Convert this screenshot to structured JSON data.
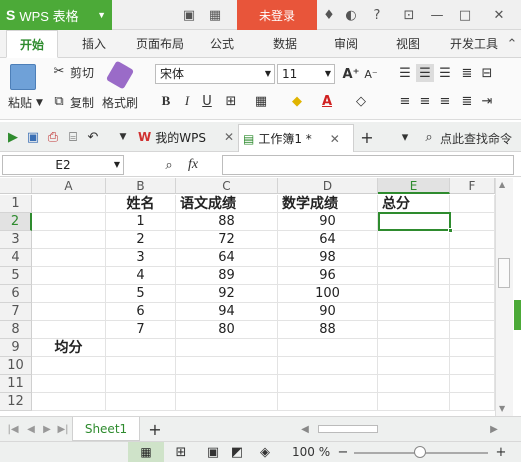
{
  "app": {
    "logo_text": "WPS 表格",
    "login_button": "未登录"
  },
  "ribbon_tabs": [
    "开始",
    "插入",
    "页面布局",
    "公式",
    "数据",
    "审阅",
    "视图",
    "开发工具"
  ],
  "ribbon": {
    "paste": "粘贴",
    "cut": "剪切",
    "copy": "复制",
    "format_painter": "格式刷",
    "font_name": "宋体",
    "font_size": "11",
    "bold": "B",
    "italic": "I",
    "underline": "U"
  },
  "doc_tabs": {
    "tab1": "我的WPS",
    "tab2": "工作簿1 *",
    "find_command": "点此查找命令"
  },
  "formula_bar": {
    "cell_ref": "E2",
    "fx": "fx",
    "value": ""
  },
  "sheet": {
    "columns": [
      "A",
      "B",
      "C",
      "D",
      "E",
      "F"
    ],
    "rows": [
      "1",
      "2",
      "3",
      "4",
      "5",
      "6",
      "7",
      "8",
      "9",
      "10",
      "11",
      "12"
    ],
    "header": {
      "name": "姓名",
      "chinese": "语文成绩",
      "math": "数学成绩",
      "total": "总分"
    },
    "data": [
      {
        "name": "1",
        "chinese": "88",
        "math": "90"
      },
      {
        "name": "2",
        "chinese": "72",
        "math": "64"
      },
      {
        "name": "3",
        "chinese": "64",
        "math": "98"
      },
      {
        "name": "4",
        "chinese": "89",
        "math": "96"
      },
      {
        "name": "5",
        "chinese": "92",
        "math": "100"
      },
      {
        "name": "6",
        "chinese": "94",
        "math": "90"
      },
      {
        "name": "7",
        "chinese": "80",
        "math": "88"
      }
    ],
    "avg_label": "均分"
  },
  "sheet_tabs": {
    "active": "Sheet1",
    "add": "+"
  },
  "status": {
    "zoom": "100 %"
  },
  "colors": {
    "brand_green": "#4caa38",
    "login_red": "#e8553a",
    "select_green": "#2e8b2e"
  }
}
